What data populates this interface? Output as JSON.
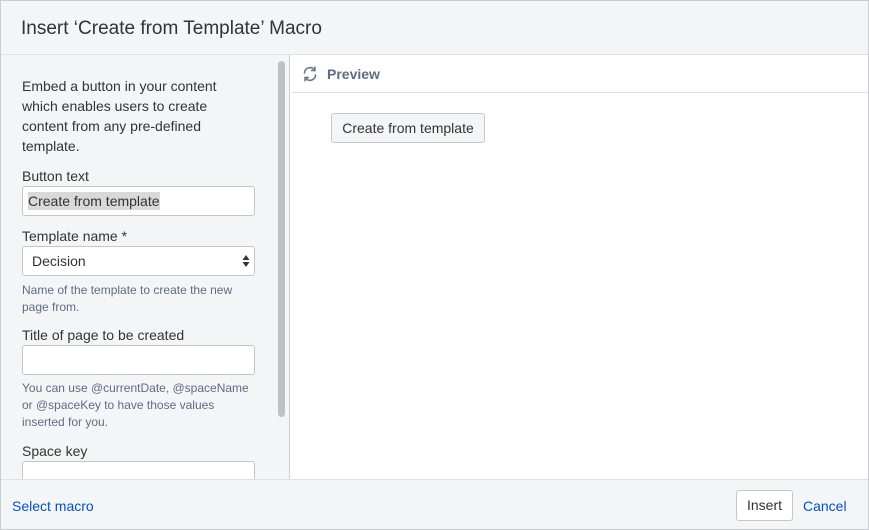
{
  "dialog": {
    "title": "Insert ‘Create from Template’ Macro"
  },
  "form": {
    "description": "Embed a button in your content which enables users to create content from any pre-defined template.",
    "button_text": {
      "label": "Button text",
      "value": "Create from template"
    },
    "template_name": {
      "label": "Template name *",
      "selected": "Decision",
      "help": "Name of the template to create the new page from."
    },
    "page_title": {
      "label": "Title of page to be created",
      "value": "",
      "help": "You can use @currentDate, @spaceName or @spaceKey to have those values inserted for you."
    },
    "space_key": {
      "label": "Space key",
      "value": ""
    }
  },
  "preview": {
    "icon": "refresh-icon",
    "label": "Preview",
    "button_label": "Create from template"
  },
  "footer": {
    "select_macro": "Select macro",
    "insert": "Insert",
    "cancel": "Cancel"
  },
  "colors": {
    "link": "#0052cc",
    "panel_bg": "#f4f5f7",
    "border": "#c1c7d0"
  }
}
